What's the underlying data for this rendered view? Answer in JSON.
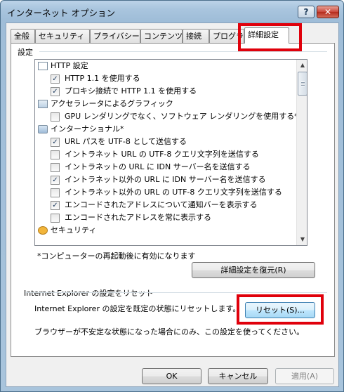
{
  "window": {
    "title": "インターネット オプション",
    "help_label": "?",
    "close_label": "✕"
  },
  "tabs": [
    {
      "label": "全般"
    },
    {
      "label": "セキュリティ"
    },
    {
      "label": "プライバシー"
    },
    {
      "label": "コンテンツ"
    },
    {
      "label": "接続"
    },
    {
      "label": "プログラム"
    },
    {
      "label": "詳細設定",
      "active": true
    }
  ],
  "settings": {
    "group_label": "設定",
    "items": [
      {
        "type": "group",
        "icon": "page-icon",
        "label": "HTTP 設定"
      },
      {
        "type": "checkbox",
        "checked": true,
        "label": "HTTP 1.1 を使用する"
      },
      {
        "type": "checkbox",
        "checked": true,
        "label": "プロキシ接続で HTTP 1.1 を使用する"
      },
      {
        "type": "group",
        "icon": "display-icon",
        "label": "アクセラレータによるグラフィック"
      },
      {
        "type": "checkbox",
        "checked": false,
        "label": "GPU レンダリングでなく、ソフトウェア レンダリングを使用する*"
      },
      {
        "type": "group",
        "icon": "globe-icon",
        "label": "インターナショナル*"
      },
      {
        "type": "checkbox",
        "checked": true,
        "label": "URL パスを UTF-8 として送信する"
      },
      {
        "type": "checkbox",
        "checked": false,
        "label": "イントラネット URL の UTF-8 クエリ文字列を送信する"
      },
      {
        "type": "checkbox",
        "checked": false,
        "label": "イントラネットの URL に IDN サーバー名を送信する"
      },
      {
        "type": "checkbox",
        "checked": true,
        "label": "イントラネット以外の URL に IDN サーバー名を送信する"
      },
      {
        "type": "checkbox",
        "checked": false,
        "label": "イントラネット以外の URL の UTF-8 クエリ文字列を送信する"
      },
      {
        "type": "checkbox",
        "checked": true,
        "label": "エンコードされたアドレスについて通知バーを表示する"
      },
      {
        "type": "checkbox",
        "checked": false,
        "label": "エンコードされたアドレスを常に表示する"
      },
      {
        "type": "group",
        "icon": "security-icon",
        "label": "セキュリティ"
      }
    ],
    "restart_note": "*コンピューターの再起動後に有効になります",
    "restore_label": "詳細設定を復元(R)"
  },
  "reset": {
    "section_label": "Internet Explorer の設定をリセット",
    "description": "Internet Explorer の設定を既定の状態にリセットします。",
    "button_label": "リセット(S)...",
    "warning": "ブラウザーが不安定な状態になった場合にのみ、この設定を使ってください。"
  },
  "footer": {
    "ok_label": "OK",
    "cancel_label": "キャンセル",
    "apply_label": "適用(A)"
  },
  "highlight_color": "#e0000b"
}
